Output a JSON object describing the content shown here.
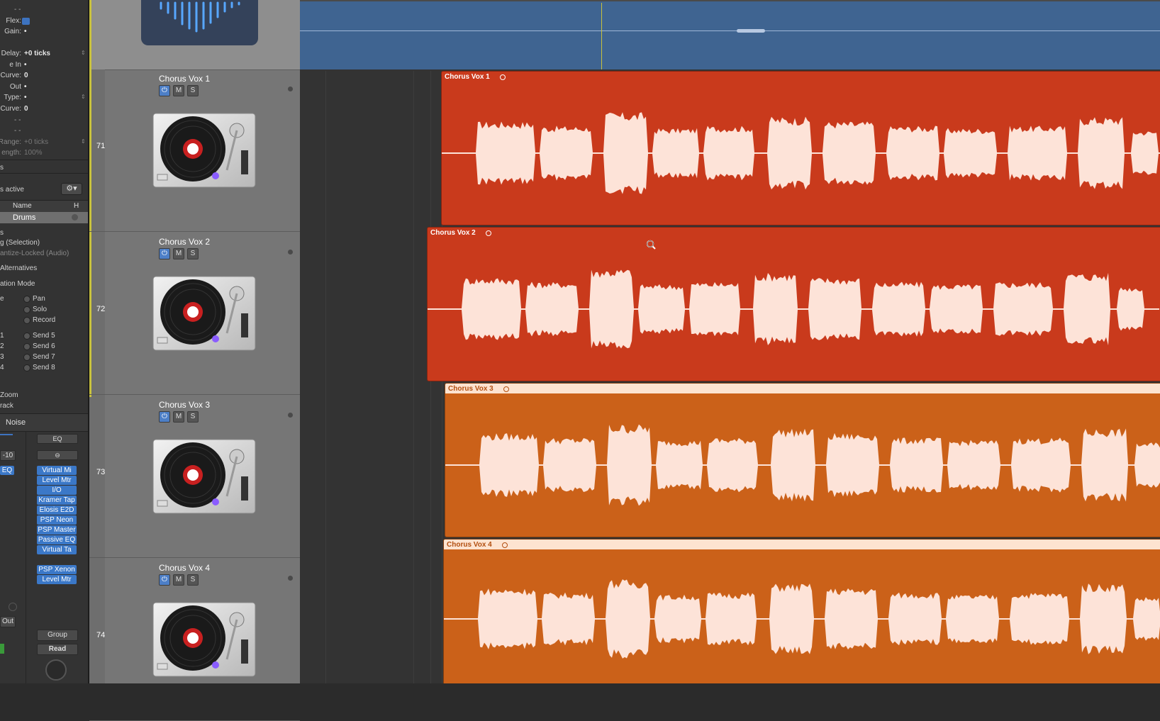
{
  "inspector": {
    "rows": [
      {
        "label": "- -",
        "value": ""
      },
      {
        "label": "Flex:",
        "value": ""
      },
      {
        "label": "Gain:",
        "value": "•"
      },
      {
        "label": "Delay:",
        "value": "+0 ticks"
      },
      {
        "label": "e In",
        "value": "•"
      },
      {
        "label": "Curve:",
        "value": "0"
      },
      {
        "label": "Out",
        "value": "•"
      },
      {
        "label": "Type:",
        "value": "•"
      },
      {
        "label": "Curve:",
        "value": "0"
      },
      {
        "label": "- -",
        "value": ""
      },
      {
        "label": "- -",
        "value": ""
      },
      {
        "label": "Range:",
        "value": "+0 ticks"
      },
      {
        "label": "ength:",
        "value": "100%"
      }
    ],
    "s_label": "s",
    "groups_active": "s active",
    "col_name": "Name",
    "col_h": "H",
    "group_name": "Drums",
    "s2_label": "s",
    "selection_label": "g (Selection)",
    "quantize_label": "antize-Locked (Audio)",
    "alternatives_label": "Alternatives",
    "automation_mode": "ation Mode",
    "checks_left": [
      "e",
      "",
      "",
      "1",
      "2",
      "3",
      "4"
    ],
    "checks": [
      "Pan",
      "Solo",
      "Record",
      "Send 5",
      "Send 6",
      "Send 7",
      "Send 8"
    ],
    "zoom_label": "Zoom",
    "track_label": "rack",
    "noise_label": "Noise",
    "eq_label": "EQ",
    "minus10": "-10",
    "left_eq": "EQ",
    "plugins": [
      "Virtual Mi",
      "Level Mtr",
      "I/O",
      "Kramer Tap",
      "Elosis E2D",
      "PSP Neon H",
      "PSP Master",
      "Passive EQ",
      "Virtual Ta"
    ],
    "sends": [
      "PSP Xenon",
      "Level Mtr"
    ],
    "out_label": "Out",
    "group_btn": "Group",
    "read_btn": "Read"
  },
  "tracks": [
    {
      "number": "71",
      "name": "Chorus Vox 1",
      "m": "M",
      "s": "S"
    },
    {
      "number": "72",
      "name": "Chorus Vox 2",
      "m": "M",
      "s": "S"
    },
    {
      "number": "73",
      "name": "Chorus Vox 3",
      "m": "M",
      "s": "S"
    },
    {
      "number": "74",
      "name": "Chorus Vox 4",
      "m": "M",
      "s": "S"
    }
  ],
  "regions": [
    {
      "name": "Chorus Vox 1",
      "color": "#c93a1c",
      "header": "#c93a1c",
      "text": "#ffffff"
    },
    {
      "name": "Chorus Vox 2",
      "color": "#c93a1c",
      "header": "#c93a1c",
      "text": "#ffffff"
    },
    {
      "name": "Chorus Vox 3",
      "color": "#cb6119",
      "header": "#fde3d0",
      "text": "#b24f10"
    },
    {
      "name": "Chorus Vox 4",
      "color": "#cb6119",
      "header": "#fde3d0",
      "text": "#b24f10"
    }
  ],
  "colors": {
    "wave": "#fde3d8",
    "top_region": "#3f6491",
    "cursor_line": "#c9c23d"
  }
}
